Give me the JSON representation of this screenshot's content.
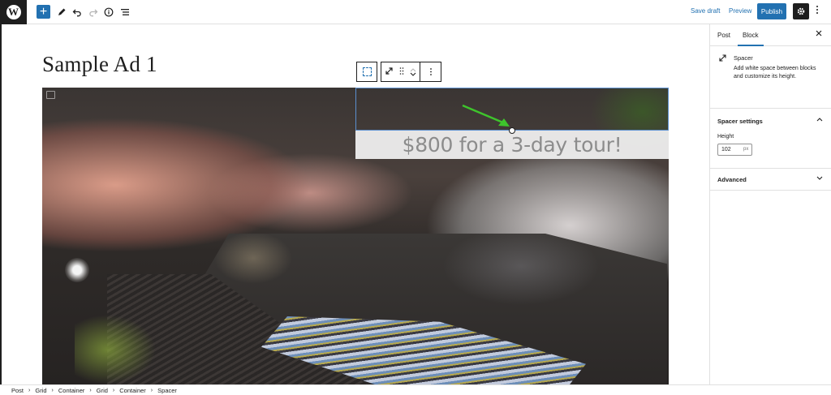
{
  "toolbar": {
    "logo_icon": "wordpress-logo",
    "add_label": "+",
    "tools_icon": "pencil-icon",
    "undo_icon": "undo-icon",
    "redo_icon": "redo-icon",
    "details_icon": "info-icon",
    "list_view_icon": "list-view-icon",
    "save_draft_label": "Save draft",
    "preview_label": "Preview",
    "publish_label": "Publish",
    "settings_icon": "gear-icon",
    "options_icon": "vertical-ellipsis-icon",
    "accent_color": "#2271b1"
  },
  "editor": {
    "post_title": "Sample Ad 1",
    "ad_text": "$800 for a 3-day tour!",
    "annotation_color": "#3ec42c"
  },
  "block_toolbar": {
    "parent_icon": "select-parent-icon",
    "block_icon": "spacer-resize-icon",
    "drag_icon": "drag-handle-icon",
    "mover_up_icon": "chevron-up-icon",
    "mover_down_icon": "chevron-down-icon",
    "more_icon": "vertical-ellipsis-icon"
  },
  "sidebar": {
    "tabs": [
      {
        "label": "Post",
        "active": false
      },
      {
        "label": "Block",
        "active": true
      }
    ],
    "close_icon": "close-icon",
    "block_card": {
      "icon": "spacer-resize-icon",
      "title": "Spacer",
      "description": "Add white space between blocks and customize its height."
    },
    "spacer_settings": {
      "title": "Spacer settings",
      "expanded": true,
      "height_label": "Height",
      "height_value": "102",
      "height_unit": "px"
    },
    "advanced": {
      "title": "Advanced",
      "expanded": false
    }
  },
  "breadcrumb": [
    "Post",
    "Grid",
    "Container",
    "Grid",
    "Container",
    "Spacer"
  ]
}
